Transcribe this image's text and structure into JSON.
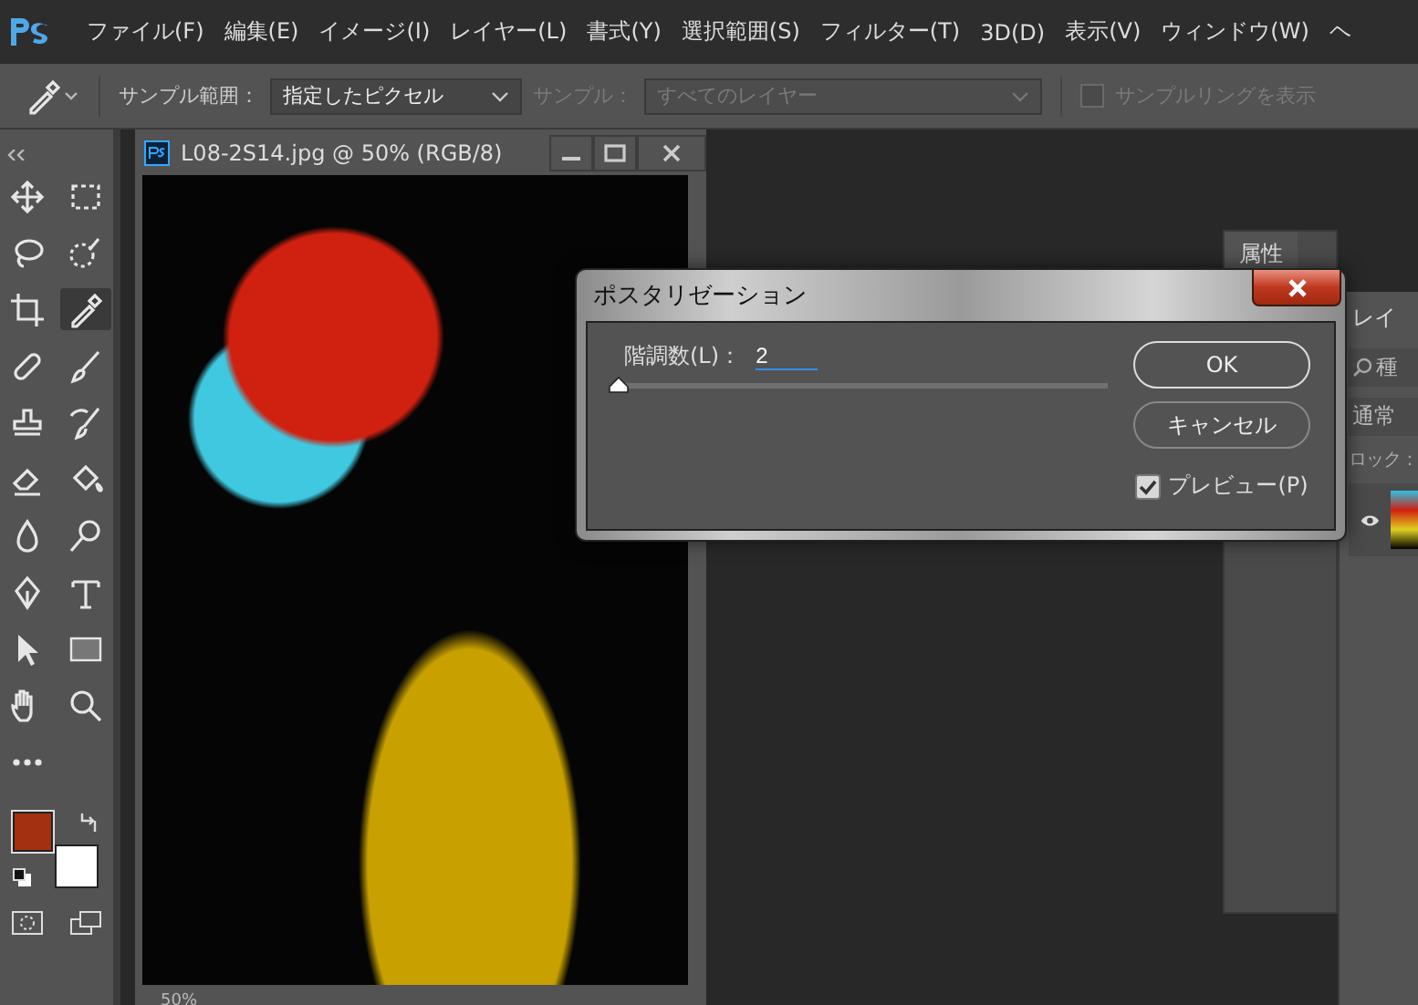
{
  "menu_bar": {
    "items": [
      "ファイル(F)",
      "編集(E)",
      "イメージ(I)",
      "レイヤー(L)",
      "書式(Y)",
      "選択範囲(S)",
      "フィルター(T)",
      "3D(D)",
      "表示(V)",
      "ウィンドウ(W)",
      "ヘ"
    ]
  },
  "options_bar": {
    "sample_size_label": "サンプル範囲：",
    "sample_size": "指定したピクセル",
    "sample_label": "サンプル：",
    "sample": "すべてのレイヤー",
    "sample_disabled": true,
    "show_ring": {
      "label": "サンプルリングを表示",
      "checked": false,
      "disabled": true
    }
  },
  "tools": [
    {
      "kind": "move",
      "selected": false
    },
    {
      "kind": "marquee",
      "selected": false
    },
    {
      "kind": "lasso",
      "selected": false
    },
    {
      "kind": "quick-select",
      "selected": false
    },
    {
      "kind": "crop",
      "selected": false
    },
    {
      "kind": "eyedropper",
      "selected": true
    },
    {
      "kind": "healing",
      "selected": false
    },
    {
      "kind": "brush",
      "selected": false
    },
    {
      "kind": "stamp",
      "selected": false
    },
    {
      "kind": "history-brush",
      "selected": false
    },
    {
      "kind": "eraser",
      "selected": false
    },
    {
      "kind": "bucket",
      "selected": false
    },
    {
      "kind": "blur",
      "selected": false
    },
    {
      "kind": "dodge",
      "selected": false
    },
    {
      "kind": "pen",
      "selected": false
    },
    {
      "kind": "type",
      "selected": false
    },
    {
      "kind": "path-select",
      "selected": false
    },
    {
      "kind": "rectangle",
      "selected": false
    },
    {
      "kind": "hand",
      "selected": false
    },
    {
      "kind": "zoom",
      "selected": false
    },
    {
      "kind": "more",
      "selected": false
    }
  ],
  "document": {
    "title": "L08-2S14.jpg @ 50% (RGB/8)",
    "zoom": "50%"
  },
  "properties_panel": {
    "tab": "属性"
  },
  "layers_panel": {
    "tab": "レイ",
    "filter": "種",
    "blend_mode": "通常",
    "lock_label": "ロック："
  },
  "dialog": {
    "title": "ポスタリゼーション",
    "levels_label": "階調数(L)：",
    "levels_value": "2",
    "level": 0,
    "buttons": [
      "OK",
      "キャンセル"
    ],
    "preview": {
      "label": "プレビュー(P)",
      "checked": true
    }
  }
}
